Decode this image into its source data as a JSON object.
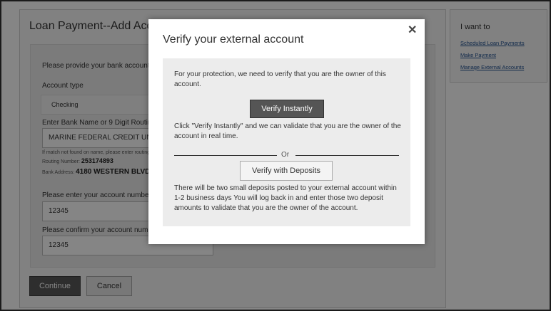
{
  "page": {
    "title": "Loan Payment--Add Account",
    "form": {
      "instructions": "Please provide your bank account information",
      "account_type_label": "Account type",
      "account_type_value": "Checking",
      "bank_name_label": "Enter Bank Name or 9 Digit Routing Number",
      "bank_name_value": "MARINE FEDERAL CREDIT UNION",
      "not_found_note": "If match not found on name, please enter routing number",
      "routing_label": "Routing Number:",
      "routing_value": "253174893",
      "address_label": "Bank Address:",
      "address_value": "4180 WESTERN BLVD",
      "account_number_label": "Please enter your account number",
      "account_number_value": "12345",
      "confirm_label": "Please confirm your account number",
      "confirm_value": "12345"
    },
    "continue_label": "Continue",
    "cancel_label": "Cancel"
  },
  "sidebar": {
    "title": "I want to",
    "links": [
      "Scheduled Loan Payments",
      "Make Payment",
      "Manage External Accounts"
    ]
  },
  "modal": {
    "title": "Verify your external account",
    "protection_text": "For your protection, we need to verify that you are the owner of this account.",
    "verify_instantly_label": "Verify Instantly",
    "instant_text": "Click \"Verify Instantly\" and we can validate that you are the owner of the account in real time.",
    "or_text": "Or",
    "verify_deposits_label": "Verify with Deposits",
    "deposits_text": "There will be two small deposits posted to your external account within 1-2 business days You will log back in and enter those two deposit amounts to validate that you are the owner of the account."
  }
}
